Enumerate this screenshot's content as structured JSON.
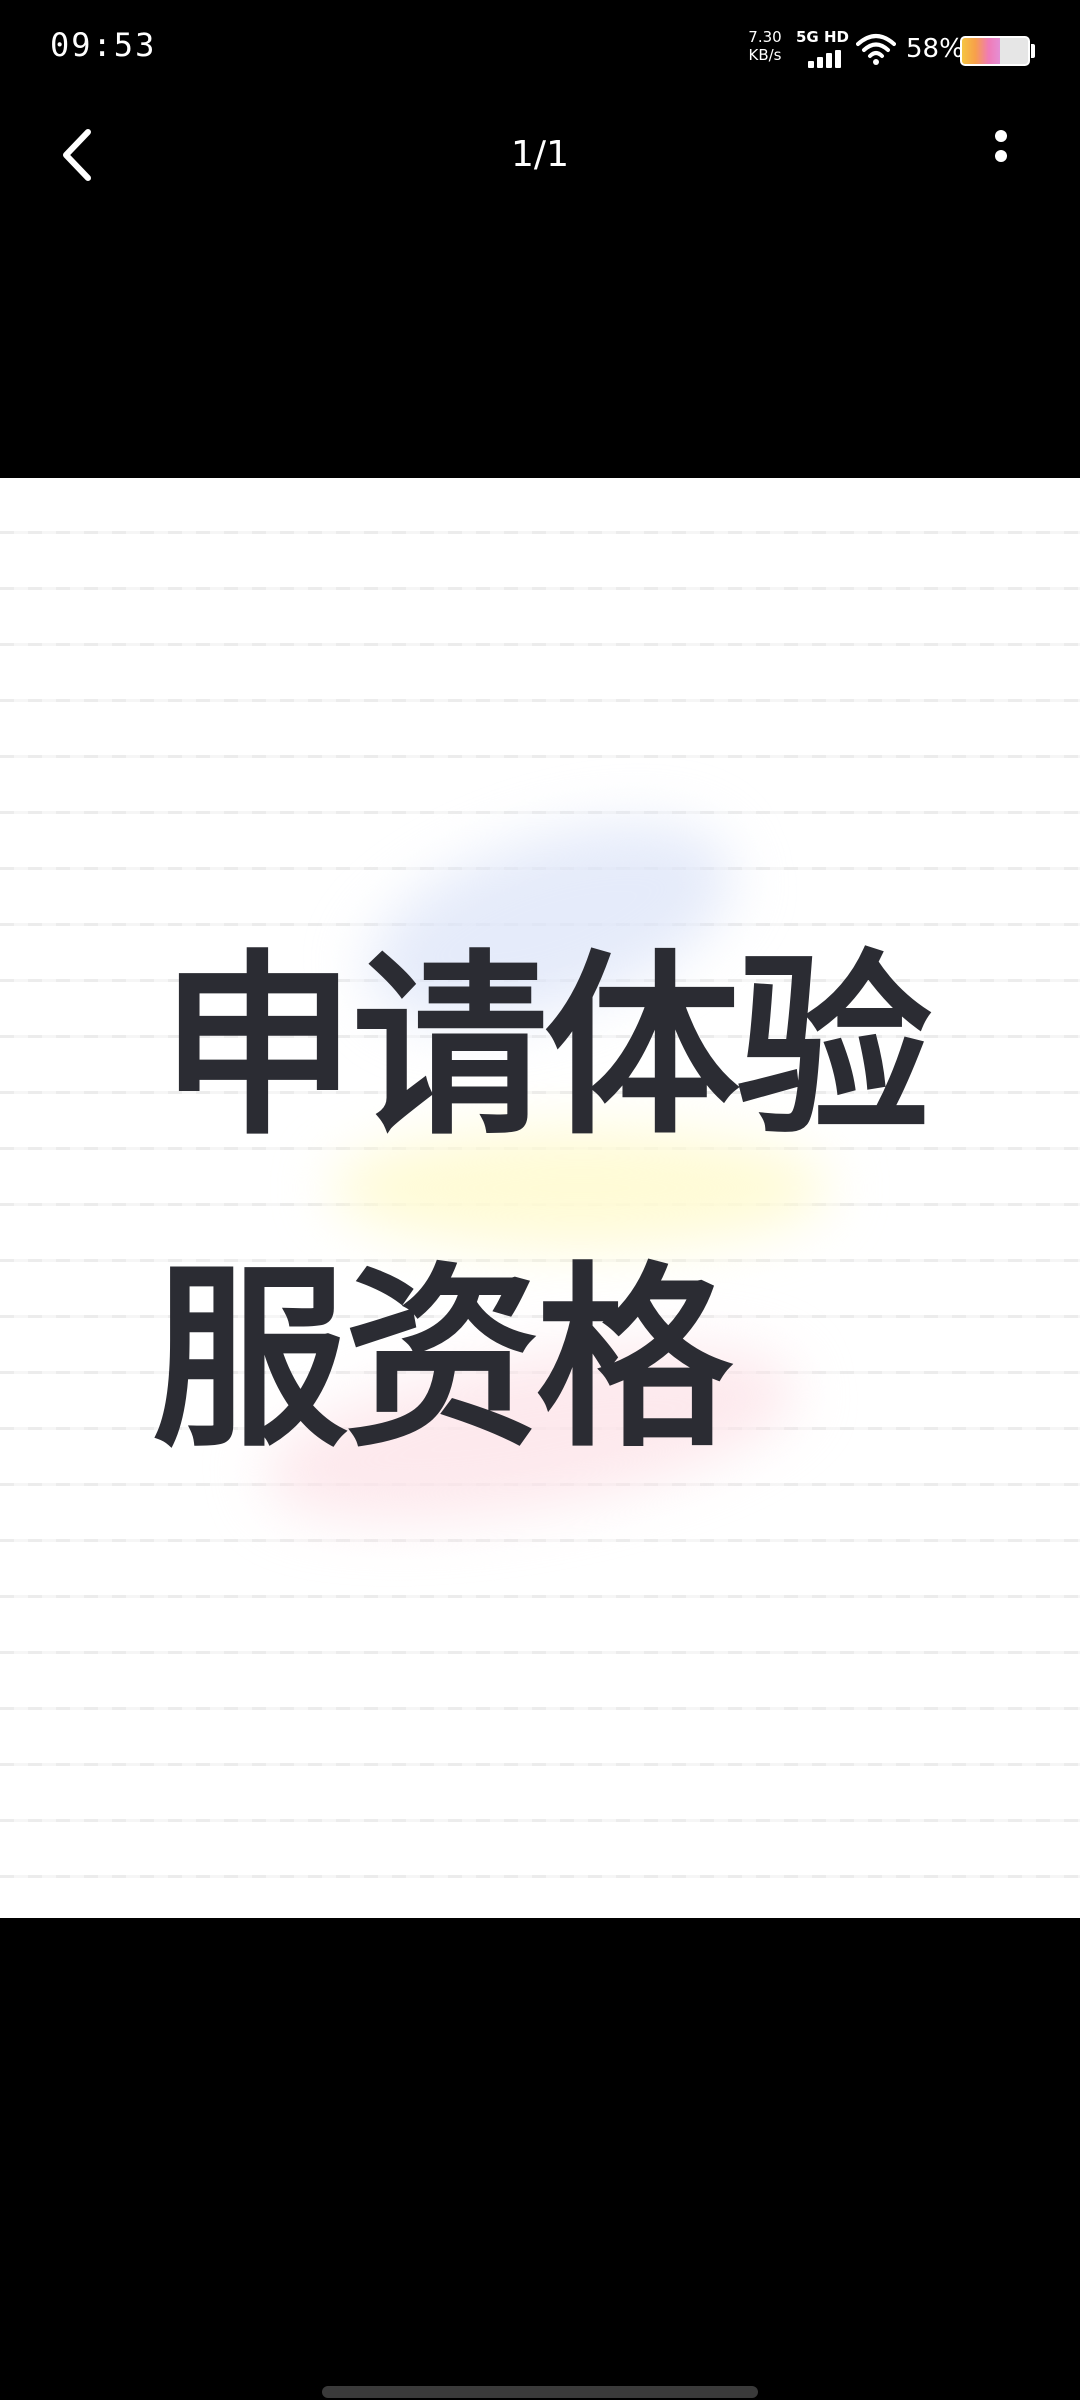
{
  "status_bar": {
    "time": "09:53",
    "net_speed_value": "7.30",
    "net_speed_unit": "KB/s",
    "network_label": "5G HD",
    "battery_percent_text": "58%",
    "battery_level": 0.58,
    "icons": [
      "signal-icon",
      "wifi-icon",
      "battery-icon"
    ]
  },
  "nav": {
    "page_counter": "1/1",
    "icons": [
      "back-arrow-icon",
      "more-vertical-icon"
    ]
  },
  "image": {
    "line1": "申请体验",
    "line2": "服资格"
  },
  "colors": {
    "background": "#000000",
    "image_background": "#ffffff",
    "headline": "#2b2c33",
    "status_text": "#ffffff"
  }
}
